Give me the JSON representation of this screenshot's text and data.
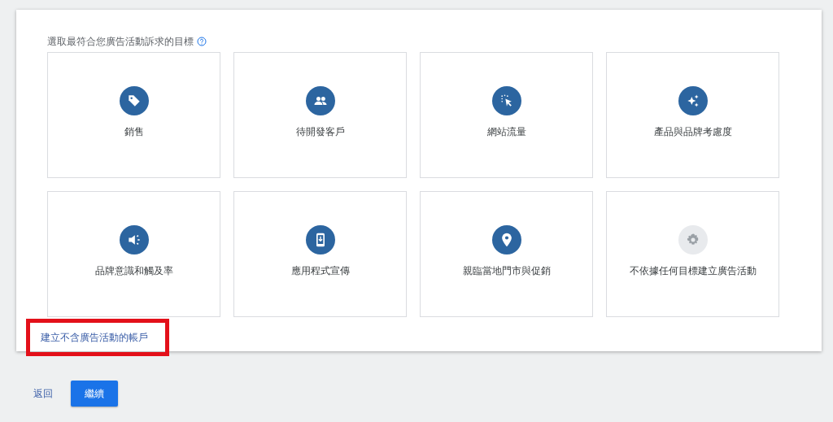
{
  "heading": "選取最符合您廣告活動訴求的目標",
  "goals": [
    {
      "kind": "tag",
      "label": "銷售"
    },
    {
      "kind": "people",
      "label": "待開發客戶"
    },
    {
      "kind": "click",
      "label": "網站流量"
    },
    {
      "kind": "sparkle",
      "label": "產品與品牌考慮度"
    },
    {
      "kind": "megaphone",
      "label": "品牌意識和觸及率"
    },
    {
      "kind": "phone",
      "label": "應用程式宣傳"
    },
    {
      "kind": "pin",
      "label": "親臨當地門市與促銷"
    },
    {
      "kind": "gear",
      "label": "不依據任何目標建立廣告活動"
    }
  ],
  "account_link": {
    "text": "建立不含廣告活動的帳戶",
    "highlighted": true
  },
  "back_link": "返回",
  "continue_button": "繼續"
}
